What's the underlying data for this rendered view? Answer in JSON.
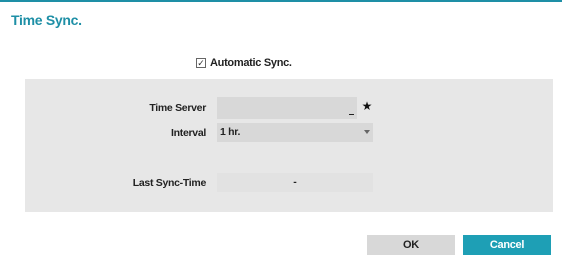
{
  "dialog": {
    "title": "Time Sync."
  },
  "automatic_sync": {
    "label": "Automatic Sync.",
    "checked": true,
    "check_glyph": "✓"
  },
  "time_server": {
    "label": "Time Server",
    "value": "",
    "favorite_icon": "star-icon",
    "favorite_glyph": "★"
  },
  "interval": {
    "label": "Interval",
    "selected": "1 hr."
  },
  "last_sync": {
    "label": "Last Sync-Time",
    "value": "-"
  },
  "buttons": {
    "ok": "OK",
    "cancel": "Cancel"
  },
  "colors": {
    "accent": "#1e8fa6",
    "cancel_button": "#1e9fb5",
    "panel": "#e7e7e7"
  }
}
